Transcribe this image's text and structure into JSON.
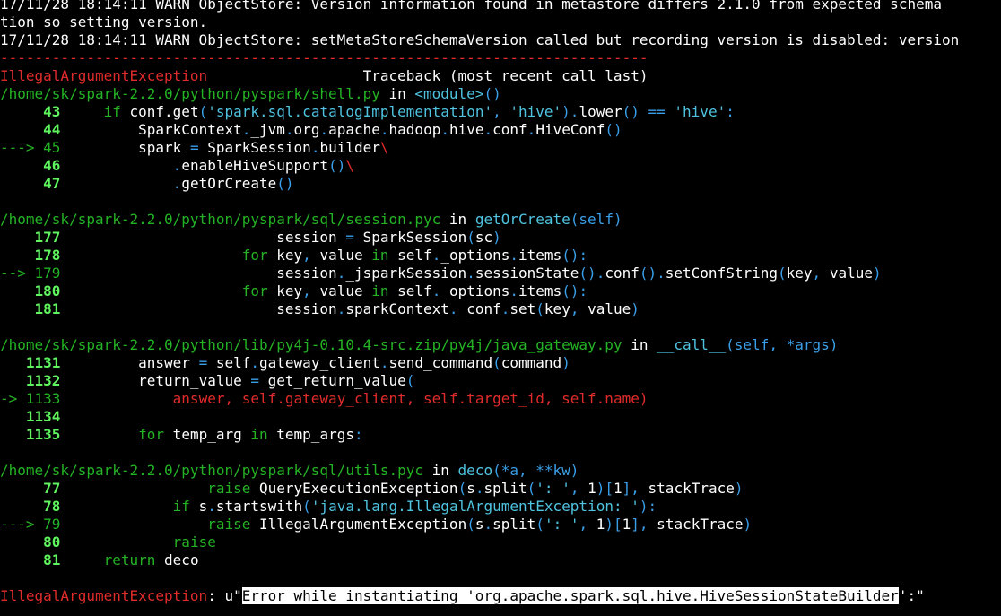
{
  "lines": [
    [
      {
        "t": "17/11/28 18:14:11 WARN ObjectStore: Version information found in metastore differs 2.1.0 from expected schema",
        "c": "white"
      }
    ],
    [
      {
        "t": "tion so setting version.",
        "c": "white"
      }
    ],
    [
      {
        "t": "17/11/28 18:14:11 WARN ObjectStore: setMetaStoreSchemaVersion called but recording version is disabled: version",
        "c": "white"
      }
    ],
    [
      {
        "t": "---------------------------------------------------------------------------",
        "c": "red"
      }
    ],
    [
      {
        "t": "IllegalArgumentException",
        "c": "red"
      },
      {
        "t": "                  Traceback (most recent call last)",
        "c": "white"
      }
    ],
    [
      {
        "t": "/home/sk/spark-2.2.0/python/pyspark/shell.py",
        "c": "green"
      },
      {
        "t": " in ",
        "c": "white"
      },
      {
        "t": "<module>",
        "c": "cyan"
      },
      {
        "t": "()",
        "c": "blue"
      }
    ],
    [
      {
        "t": "     43",
        "c": "bgreen"
      },
      {
        "t": "     ",
        "c": "white"
      },
      {
        "t": "if",
        "c": "green"
      },
      {
        "t": " conf.get",
        "c": "white"
      },
      {
        "t": "(",
        "c": "blue"
      },
      {
        "t": "'spark.sql.catalogImplementation'",
        "c": "cyan"
      },
      {
        "t": ", ",
        "c": "blue"
      },
      {
        "t": "'hive'",
        "c": "cyan"
      },
      {
        "t": ").",
        "c": "blue"
      },
      {
        "t": "lower",
        "c": "white"
      },
      {
        "t": "()",
        "c": "blue"
      },
      {
        "t": " == ",
        "c": "blue"
      },
      {
        "t": "'hive'",
        "c": "cyan"
      },
      {
        "t": ":",
        "c": "blue"
      }
    ],
    [
      {
        "t": "     44",
        "c": "bgreen"
      },
      {
        "t": "         SparkContext",
        "c": "white"
      },
      {
        "t": ".",
        "c": "blue"
      },
      {
        "t": "_jvm",
        "c": "white"
      },
      {
        "t": ".",
        "c": "blue"
      },
      {
        "t": "org",
        "c": "white"
      },
      {
        "t": ".",
        "c": "blue"
      },
      {
        "t": "apache",
        "c": "white"
      },
      {
        "t": ".",
        "c": "blue"
      },
      {
        "t": "hadoop",
        "c": "white"
      },
      {
        "t": ".",
        "c": "blue"
      },
      {
        "t": "hive",
        "c": "white"
      },
      {
        "t": ".",
        "c": "blue"
      },
      {
        "t": "conf",
        "c": "white"
      },
      {
        "t": ".",
        "c": "blue"
      },
      {
        "t": "HiveConf",
        "c": "white"
      },
      {
        "t": "()",
        "c": "blue"
      }
    ],
    [
      {
        "t": "---> 45",
        "c": "green"
      },
      {
        "t": "         spark ",
        "c": "white"
      },
      {
        "t": "=",
        "c": "blue"
      },
      {
        "t": " SparkSession",
        "c": "white"
      },
      {
        "t": ".",
        "c": "blue"
      },
      {
        "t": "builder",
        "c": "white"
      },
      {
        "t": "\\",
        "c": "red"
      }
    ],
    [
      {
        "t": "     46",
        "c": "bgreen"
      },
      {
        "t": "             ",
        "c": "white"
      },
      {
        "t": ".",
        "c": "blue"
      },
      {
        "t": "enableHiveSupport",
        "c": "white"
      },
      {
        "t": "()",
        "c": "blue"
      },
      {
        "t": "\\",
        "c": "red"
      }
    ],
    [
      {
        "t": "     47",
        "c": "bgreen"
      },
      {
        "t": "             ",
        "c": "white"
      },
      {
        "t": ".",
        "c": "blue"
      },
      {
        "t": "getOrCreate",
        "c": "white"
      },
      {
        "t": "()",
        "c": "blue"
      }
    ],
    [],
    [
      {
        "t": "/home/sk/spark-2.2.0/python/pyspark/sql/session.pyc",
        "c": "green"
      },
      {
        "t": " in ",
        "c": "white"
      },
      {
        "t": "getOrCreate",
        "c": "cyan"
      },
      {
        "t": "(self)",
        "c": "blue"
      }
    ],
    [
      {
        "t": "    177",
        "c": "bgreen"
      },
      {
        "t": "                         session ",
        "c": "white"
      },
      {
        "t": "=",
        "c": "blue"
      },
      {
        "t": " SparkSession",
        "c": "white"
      },
      {
        "t": "(",
        "c": "blue"
      },
      {
        "t": "sc",
        "c": "white"
      },
      {
        "t": ")",
        "c": "blue"
      }
    ],
    [
      {
        "t": "    178",
        "c": "bgreen"
      },
      {
        "t": "                     ",
        "c": "white"
      },
      {
        "t": "for",
        "c": "green"
      },
      {
        "t": " key",
        "c": "white"
      },
      {
        "t": ",",
        "c": "blue"
      },
      {
        "t": " value ",
        "c": "white"
      },
      {
        "t": "in",
        "c": "green"
      },
      {
        "t": " self",
        "c": "white"
      },
      {
        "t": ".",
        "c": "blue"
      },
      {
        "t": "_options",
        "c": "white"
      },
      {
        "t": ".",
        "c": "blue"
      },
      {
        "t": "items",
        "c": "white"
      },
      {
        "t": "():",
        "c": "blue"
      }
    ],
    [
      {
        "t": "--> 179",
        "c": "green"
      },
      {
        "t": "                         session",
        "c": "white"
      },
      {
        "t": ".",
        "c": "blue"
      },
      {
        "t": "_jsparkSession",
        "c": "white"
      },
      {
        "t": ".",
        "c": "blue"
      },
      {
        "t": "sessionState",
        "c": "white"
      },
      {
        "t": "().",
        "c": "blue"
      },
      {
        "t": "conf",
        "c": "white"
      },
      {
        "t": "().",
        "c": "blue"
      },
      {
        "t": "setConfString",
        "c": "white"
      },
      {
        "t": "(",
        "c": "blue"
      },
      {
        "t": "key",
        "c": "white"
      },
      {
        "t": ",",
        "c": "blue"
      },
      {
        "t": " value",
        "c": "white"
      },
      {
        "t": ")",
        "c": "blue"
      }
    ],
    [
      {
        "t": "    180",
        "c": "bgreen"
      },
      {
        "t": "                     ",
        "c": "white"
      },
      {
        "t": "for",
        "c": "green"
      },
      {
        "t": " key",
        "c": "white"
      },
      {
        "t": ",",
        "c": "blue"
      },
      {
        "t": " value ",
        "c": "white"
      },
      {
        "t": "in",
        "c": "green"
      },
      {
        "t": " self",
        "c": "white"
      },
      {
        "t": ".",
        "c": "blue"
      },
      {
        "t": "_options",
        "c": "white"
      },
      {
        "t": ".",
        "c": "blue"
      },
      {
        "t": "items",
        "c": "white"
      },
      {
        "t": "():",
        "c": "blue"
      }
    ],
    [
      {
        "t": "    181",
        "c": "bgreen"
      },
      {
        "t": "                         session",
        "c": "white"
      },
      {
        "t": ".",
        "c": "blue"
      },
      {
        "t": "sparkContext",
        "c": "white"
      },
      {
        "t": ".",
        "c": "blue"
      },
      {
        "t": "_conf",
        "c": "white"
      },
      {
        "t": ".",
        "c": "blue"
      },
      {
        "t": "set",
        "c": "white"
      },
      {
        "t": "(",
        "c": "blue"
      },
      {
        "t": "key",
        "c": "white"
      },
      {
        "t": ",",
        "c": "blue"
      },
      {
        "t": " value",
        "c": "white"
      },
      {
        "t": ")",
        "c": "blue"
      }
    ],
    [],
    [
      {
        "t": "/home/sk/spark-2.2.0/python/lib/py4j-0.10.4-src.zip/py4j/java_gateway.py",
        "c": "green"
      },
      {
        "t": " in ",
        "c": "white"
      },
      {
        "t": "__call__",
        "c": "cyan"
      },
      {
        "t": "(self, *args)",
        "c": "blue"
      }
    ],
    [
      {
        "t": "   1131",
        "c": "bgreen"
      },
      {
        "t": "         answer ",
        "c": "white"
      },
      {
        "t": "=",
        "c": "blue"
      },
      {
        "t": " self",
        "c": "white"
      },
      {
        "t": ".",
        "c": "blue"
      },
      {
        "t": "gateway_client",
        "c": "white"
      },
      {
        "t": ".",
        "c": "blue"
      },
      {
        "t": "send_command",
        "c": "white"
      },
      {
        "t": "(",
        "c": "blue"
      },
      {
        "t": "command",
        "c": "white"
      },
      {
        "t": ")",
        "c": "blue"
      }
    ],
    [
      {
        "t": "   1132",
        "c": "bgreen"
      },
      {
        "t": "         return_value ",
        "c": "white"
      },
      {
        "t": "=",
        "c": "blue"
      },
      {
        "t": " get_return_value",
        "c": "white"
      },
      {
        "t": "(",
        "c": "blue"
      }
    ],
    [
      {
        "t": "-> 1133",
        "c": "green"
      },
      {
        "t": "             answer, self.gateway_client, self.target_id, self.name)",
        "c": "red"
      }
    ],
    [
      {
        "t": "   1134",
        "c": "bgreen"
      }
    ],
    [
      {
        "t": "   1135",
        "c": "bgreen"
      },
      {
        "t": "         ",
        "c": "white"
      },
      {
        "t": "for",
        "c": "green"
      },
      {
        "t": " temp_arg ",
        "c": "white"
      },
      {
        "t": "in",
        "c": "green"
      },
      {
        "t": " temp_args",
        "c": "white"
      },
      {
        "t": ":",
        "c": "blue"
      }
    ],
    [],
    [
      {
        "t": "/home/sk/spark-2.2.0/python/pyspark/sql/utils.pyc",
        "c": "green"
      },
      {
        "t": " in ",
        "c": "white"
      },
      {
        "t": "deco",
        "c": "cyan"
      },
      {
        "t": "(*a, **kw)",
        "c": "blue"
      }
    ],
    [
      {
        "t": "     77",
        "c": "bgreen"
      },
      {
        "t": "                 ",
        "c": "white"
      },
      {
        "t": "raise",
        "c": "green"
      },
      {
        "t": " QueryExecutionException",
        "c": "white"
      },
      {
        "t": "(",
        "c": "blue"
      },
      {
        "t": "s",
        "c": "white"
      },
      {
        "t": ".",
        "c": "blue"
      },
      {
        "t": "split",
        "c": "white"
      },
      {
        "t": "(",
        "c": "blue"
      },
      {
        "t": "': '",
        "c": "cyan"
      },
      {
        "t": ",",
        "c": "blue"
      },
      {
        "t": " 1",
        "c": "white"
      },
      {
        "t": ")[",
        "c": "blue"
      },
      {
        "t": "1",
        "c": "white"
      },
      {
        "t": "],",
        "c": "blue"
      },
      {
        "t": " stackTrace",
        "c": "white"
      },
      {
        "t": ")",
        "c": "blue"
      }
    ],
    [
      {
        "t": "     78",
        "c": "bgreen"
      },
      {
        "t": "             ",
        "c": "white"
      },
      {
        "t": "if",
        "c": "green"
      },
      {
        "t": " s",
        "c": "white"
      },
      {
        "t": ".",
        "c": "blue"
      },
      {
        "t": "startswith",
        "c": "white"
      },
      {
        "t": "(",
        "c": "blue"
      },
      {
        "t": "'java.lang.IllegalArgumentException: '",
        "c": "cyan"
      },
      {
        "t": "):",
        "c": "blue"
      }
    ],
    [
      {
        "t": "---> 79",
        "c": "green"
      },
      {
        "t": "                 ",
        "c": "white"
      },
      {
        "t": "raise",
        "c": "green"
      },
      {
        "t": " IllegalArgumentException",
        "c": "white"
      },
      {
        "t": "(",
        "c": "blue"
      },
      {
        "t": "s",
        "c": "white"
      },
      {
        "t": ".",
        "c": "blue"
      },
      {
        "t": "split",
        "c": "white"
      },
      {
        "t": "(",
        "c": "blue"
      },
      {
        "t": "': '",
        "c": "cyan"
      },
      {
        "t": ",",
        "c": "blue"
      },
      {
        "t": " 1",
        "c": "white"
      },
      {
        "t": ")[",
        "c": "blue"
      },
      {
        "t": "1",
        "c": "white"
      },
      {
        "t": "],",
        "c": "blue"
      },
      {
        "t": " stackTrace",
        "c": "white"
      },
      {
        "t": ")",
        "c": "blue"
      }
    ],
    [
      {
        "t": "     80",
        "c": "bgreen"
      },
      {
        "t": "             ",
        "c": "white"
      },
      {
        "t": "raise",
        "c": "green"
      }
    ],
    [
      {
        "t": "     81",
        "c": "bgreen"
      },
      {
        "t": "     ",
        "c": "white"
      },
      {
        "t": "return",
        "c": "green"
      },
      {
        "t": " deco",
        "c": "white"
      }
    ],
    [],
    [
      {
        "t": "IllegalArgumentException",
        "c": "red"
      },
      {
        "t": ": u\"",
        "c": "white"
      },
      {
        "t": "Error while instantiating 'org.apache.spark.sql.hive.HiveSessionStateBuilder",
        "c": "hl"
      },
      {
        "t": "':\"",
        "c": "white"
      }
    ]
  ]
}
